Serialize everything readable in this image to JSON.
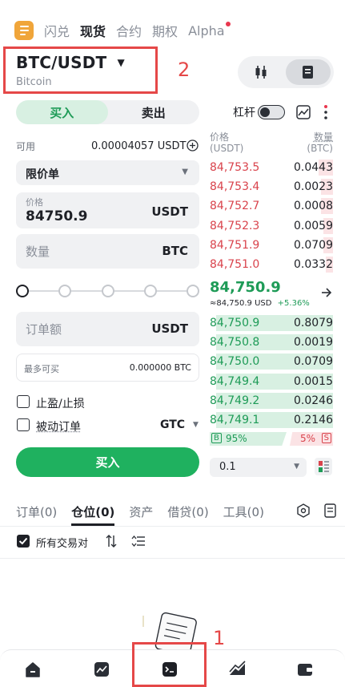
{
  "nav": {
    "tabs": [
      "闪兑",
      "现货",
      "合约",
      "期权",
      "Alpha"
    ],
    "active": "现货"
  },
  "pair": {
    "symbol": "BTC/USDT",
    "name": "Bitcoin"
  },
  "annotations": {
    "label_1": "1",
    "label_2": "2"
  },
  "trade": {
    "buy_label": "买入",
    "sell_label": "卖出",
    "leverage_label": "杠杆",
    "available_label": "可用",
    "available_value": "0.00004057 USDT",
    "order_type": "限价单",
    "price_label": "价格",
    "price_value": "84750.9",
    "price_unit": "USDT",
    "qty_placeholder": "数量",
    "qty_unit": "BTC",
    "amount_placeholder": "订单额",
    "amount_unit": "USDT",
    "max_buy_label": "最多可买",
    "max_buy_value": "0.000000 BTC",
    "tpsl_label": "止盈/止损",
    "passive_label": "被动订单",
    "tif_value": "GTC",
    "submit_label": "买入",
    "slider_positions": 5
  },
  "orderbook": {
    "price_header": "价格",
    "price_unit": "(USDT)",
    "qty_header": "数量",
    "qty_unit": "(BTC)",
    "asks": [
      {
        "price": "84,753.5",
        "qty": "0.0443",
        "depth": 0.12
      },
      {
        "price": "84,753.4",
        "qty": "0.0023",
        "depth": 0.1
      },
      {
        "price": "84,752.7",
        "qty": "0.0008",
        "depth": 0.1
      },
      {
        "price": "84,752.3",
        "qty": "0.0059",
        "depth": 0.08
      },
      {
        "price": "84,751.9",
        "qty": "0.0709",
        "depth": 0.08
      },
      {
        "price": "84,751.0",
        "qty": "0.0332",
        "depth": 0.06
      }
    ],
    "last_price": "84,750.9",
    "last_usd": "≈84,750.9 USD",
    "change": "+5.36%",
    "bids": [
      {
        "price": "84,750.9",
        "qty": "0.8079",
        "depth": 0.95
      },
      {
        "price": "84,750.8",
        "qty": "0.0019",
        "depth": 0.95
      },
      {
        "price": "84,750.0",
        "qty": "0.0709",
        "depth": 0.95
      },
      {
        "price": "84,749.4",
        "qty": "0.0015",
        "depth": 0.95
      },
      {
        "price": "84,749.2",
        "qty": "0.0246",
        "depth": 0.95
      },
      {
        "price": "84,749.1",
        "qty": "0.2146",
        "depth": 0.95
      }
    ],
    "buy_ratio": "95%",
    "sell_ratio": "5%",
    "buy_tag": "B",
    "sell_tag": "S",
    "precision": "0.1"
  },
  "bottom": {
    "tabs": [
      "订单(0)",
      "仓位(0)",
      "资产",
      "借贷(0)",
      "工具(0)"
    ],
    "active": "仓位(0)",
    "all_pairs_label": "所有交易对"
  },
  "colors": {
    "buy": "#1fb15f",
    "sell": "#d9434c",
    "annotation": "#e54848"
  }
}
